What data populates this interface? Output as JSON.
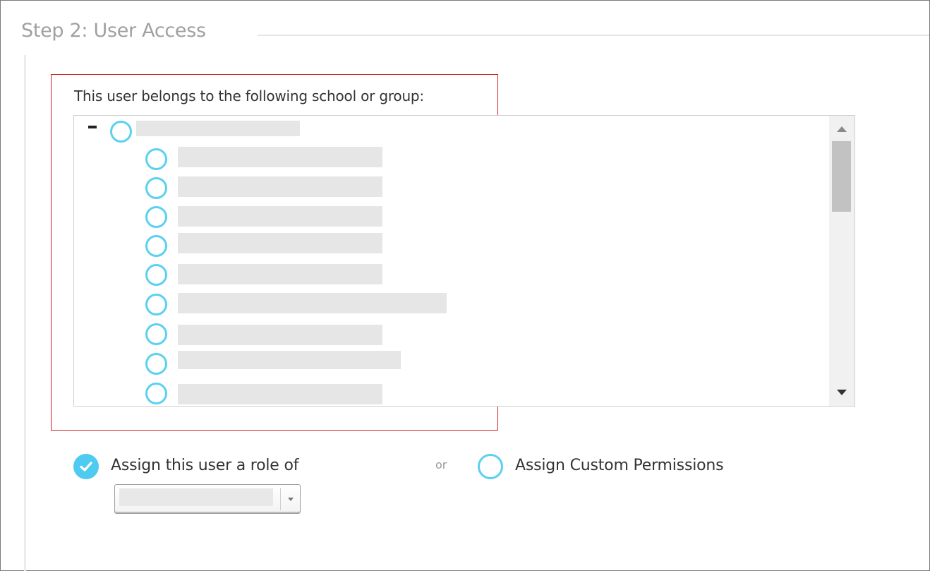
{
  "section": {
    "title": "Step 2: User Access"
  },
  "group_selector": {
    "label": "This user belongs to the following school or group:",
    "root_node": {
      "text": "",
      "selected": false,
      "expanded": true
    },
    "child_nodes": [
      {
        "text": "",
        "selected": false
      },
      {
        "text": "",
        "selected": false
      },
      {
        "text": "",
        "selected": false
      },
      {
        "text": "",
        "selected": false
      },
      {
        "text": "",
        "selected": false
      },
      {
        "text": "",
        "selected": false
      },
      {
        "text": "",
        "selected": false
      },
      {
        "text": "",
        "selected": false
      },
      {
        "text": "",
        "selected": false
      }
    ]
  },
  "permissions": {
    "role_option_label": "Assign this user a role of",
    "role_option_selected": true,
    "or_label": "or",
    "custom_option_label": "Assign Custom Permissions",
    "custom_option_selected": false,
    "role_select_value": ""
  },
  "colors": {
    "accent": "#5bd0f1",
    "highlight_border": "#cc1f1f",
    "redacted_fill": "#e6e6e6"
  },
  "icons": {
    "check": "checkmark-icon",
    "collapse": "minus-icon",
    "scroll_up": "triangle-up-icon",
    "scroll_down": "triangle-down-icon",
    "select_arrow": "caret-down-icon"
  }
}
